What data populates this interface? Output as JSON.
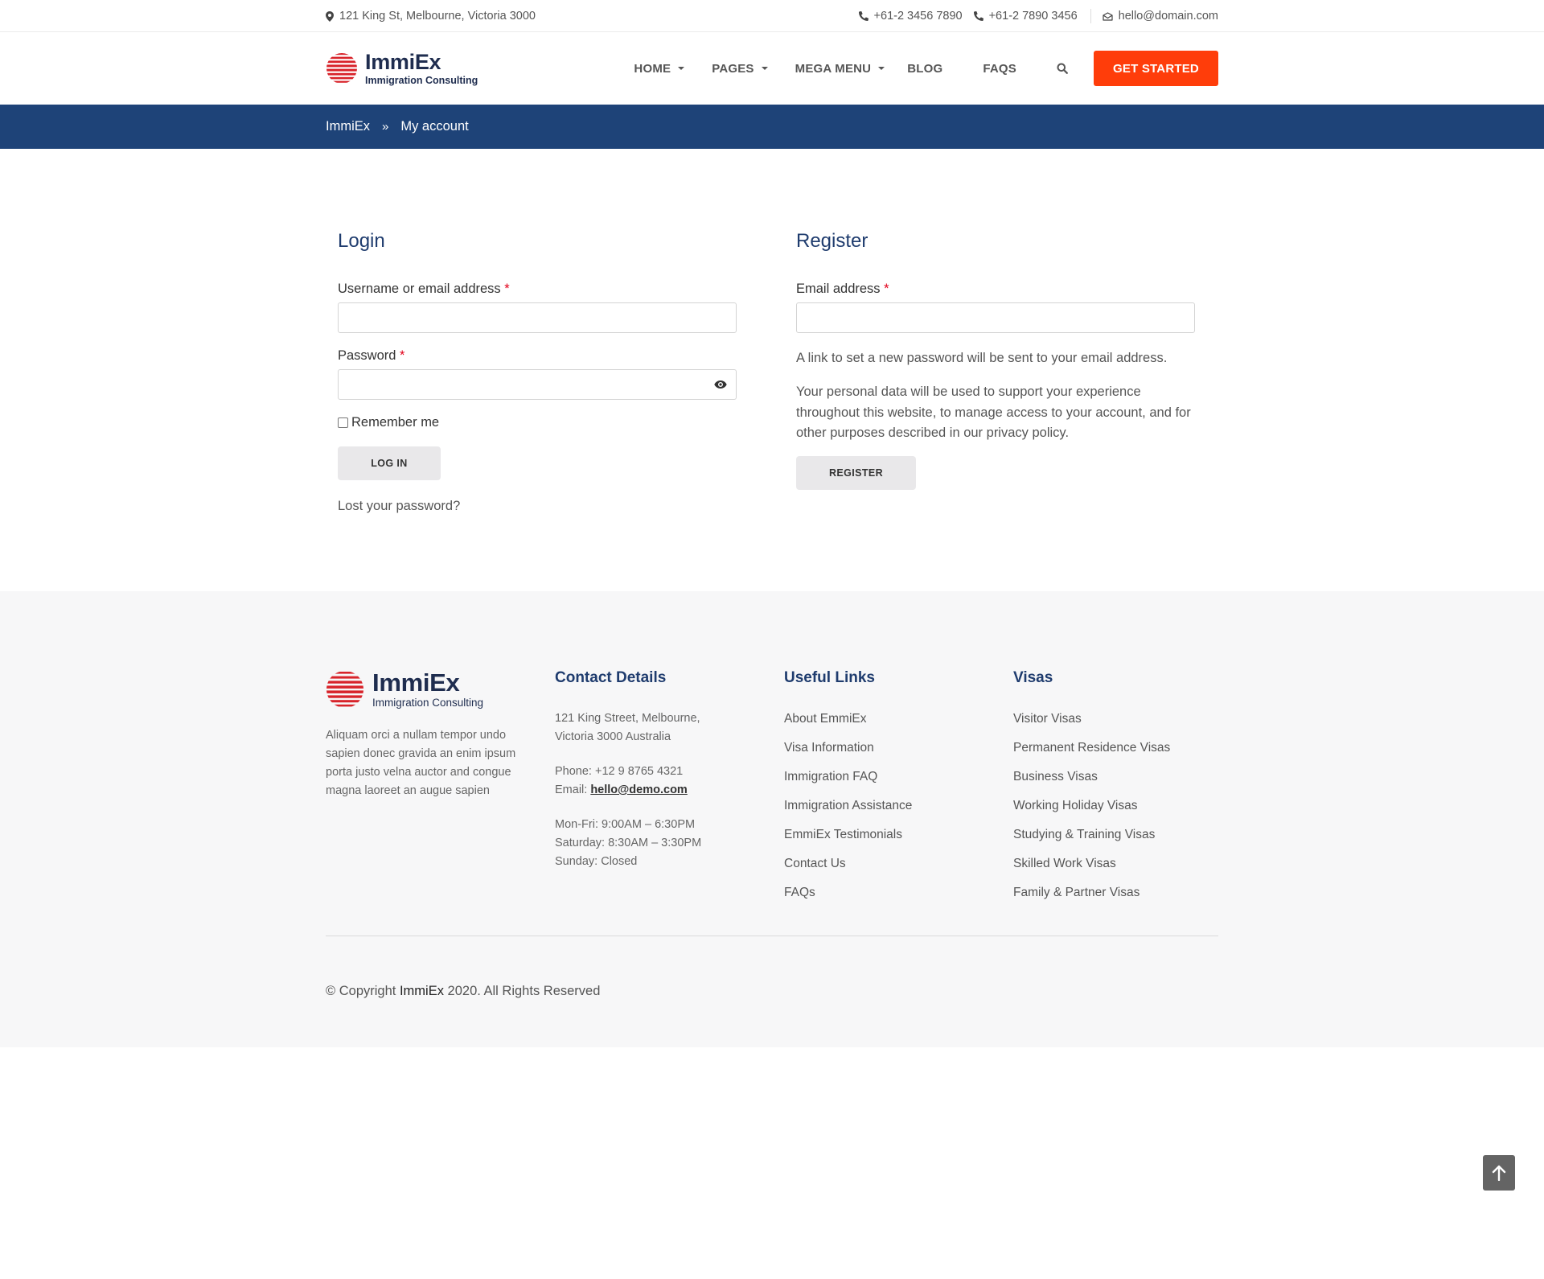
{
  "topbar": {
    "address": "121 King St, Melbourne, Victoria 3000",
    "phone1": "+61-2 3456 7890",
    "phone2": "+61-2 7890 3456",
    "email": "hello@domain.com"
  },
  "header": {
    "logo_name": "ImmiEx",
    "logo_sub": "Immigration Consulting",
    "nav": [
      "HOME",
      "PAGES",
      "MEGA MENU",
      "BLOG",
      "FAQS"
    ],
    "cta": "GET STARTED"
  },
  "breadcrumb": {
    "home": "ImmiEx",
    "separator": "»",
    "current": "My account"
  },
  "login": {
    "title": "Login",
    "username_label": "Username or email address",
    "password_label": "Password",
    "required_mark": "*",
    "remember": "Remember me",
    "button": "LOG IN",
    "lost": "Lost your password?"
  },
  "register": {
    "title": "Register",
    "email_label": "Email address",
    "required_mark": "*",
    "note": "A link to set a new password will be sent to your email address.",
    "privacy": "Your personal data will be used to support your experience throughout this website, to manage access to your account, and for other purposes described in our privacy policy.",
    "button": "REGISTER"
  },
  "footer": {
    "logo_name": "ImmiEx",
    "logo_sub": "Immigration Consulting",
    "about": "Aliquam orci a nullam tempor undo sapien donec gravida an enim ipsum porta justo velna auctor and congue magna laoreet an augue sapien",
    "contact": {
      "title": "Contact Details",
      "address_line1": "121 King Street, Melbourne,",
      "address_line2": "Victoria 3000 Australia",
      "phone": "Phone: +12 9 8765 4321",
      "email_label": "Email: ",
      "email": "hello@demo.com",
      "hours1": "Mon-Fri: 9:00AM – 6:30PM",
      "hours2": "Saturday: 8:30AM – 3:30PM",
      "hours3": "Sunday: Closed"
    },
    "useful": {
      "title": "Useful Links",
      "links": [
        "About EmmiEx",
        "Visa Information",
        "Immigration FAQ",
        "Immigration Assistance",
        "EmmiEx Testimonials",
        "Contact Us",
        "FAQs"
      ]
    },
    "visas": {
      "title": "Visas",
      "links": [
        "Visitor Visas",
        "Permanent Residence Visas",
        "Business Visas",
        "Working Holiday Visas",
        "Studying & Training Visas",
        "Skilled Work Visas",
        "Family & Partner Visas"
      ]
    },
    "copyright_prefix": "© Copyright ",
    "copyright_brand": "ImmiEx",
    "copyright_suffix": " 2020. All Rights Reserved"
  },
  "colors": {
    "accent": "#ff3d0a",
    "navy": "#1e4378",
    "logo_red": "#d8232a"
  },
  "icons": [
    "map-pin-icon",
    "phone-icon",
    "envelope-icon",
    "search-icon",
    "eye-icon",
    "arrow-up-icon"
  ]
}
